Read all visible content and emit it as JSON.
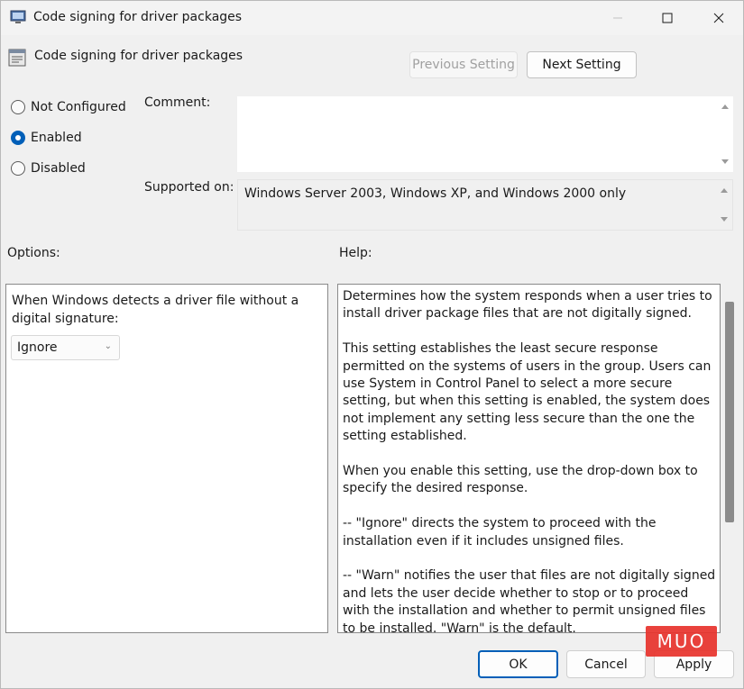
{
  "window": {
    "title": "Code signing for driver packages"
  },
  "header": {
    "setting_title": "Code signing for driver packages",
    "previous_label": "Previous Setting",
    "next_label": "Next Setting"
  },
  "state": {
    "options": [
      {
        "label": "Not Configured",
        "selected": false
      },
      {
        "label": "Enabled",
        "selected": true
      },
      {
        "label": "Disabled",
        "selected": false
      }
    ]
  },
  "labels": {
    "comment": "Comment:",
    "supported_on": "Supported on:",
    "options": "Options:",
    "help": "Help:"
  },
  "comment_value": "",
  "supported_on_value": "Windows Server 2003, Windows XP, and Windows 2000 only",
  "options_panel": {
    "prompt": "When Windows detects a driver file without a digital signature:",
    "dropdown_value": "Ignore"
  },
  "help": {
    "paragraphs": [
      "Determines how the system responds when a user tries to install driver package files that are not digitally signed.",
      "This setting establishes the least secure response permitted on the systems of users in the group. Users can use System in Control Panel to select a more secure setting, but when this setting is enabled, the system does not implement any setting less secure than the one the setting established.",
      "When you enable this setting, use the drop-down box to specify the desired response.",
      "--   \"Ignore\" directs the system to proceed with the installation even if it includes unsigned files.",
      "--   \"Warn\" notifies the user that files are not digitally signed and lets the user decide whether to stop or to proceed with the installation and whether to permit unsigned files to be installed. \"Warn\" is the default."
    ]
  },
  "footer": {
    "ok_label": "OK",
    "cancel_label": "Cancel",
    "apply_label": "Apply"
  },
  "watermark": "MUO",
  "colors": {
    "accent": "#005fb8",
    "watermark": "#e8332c"
  }
}
